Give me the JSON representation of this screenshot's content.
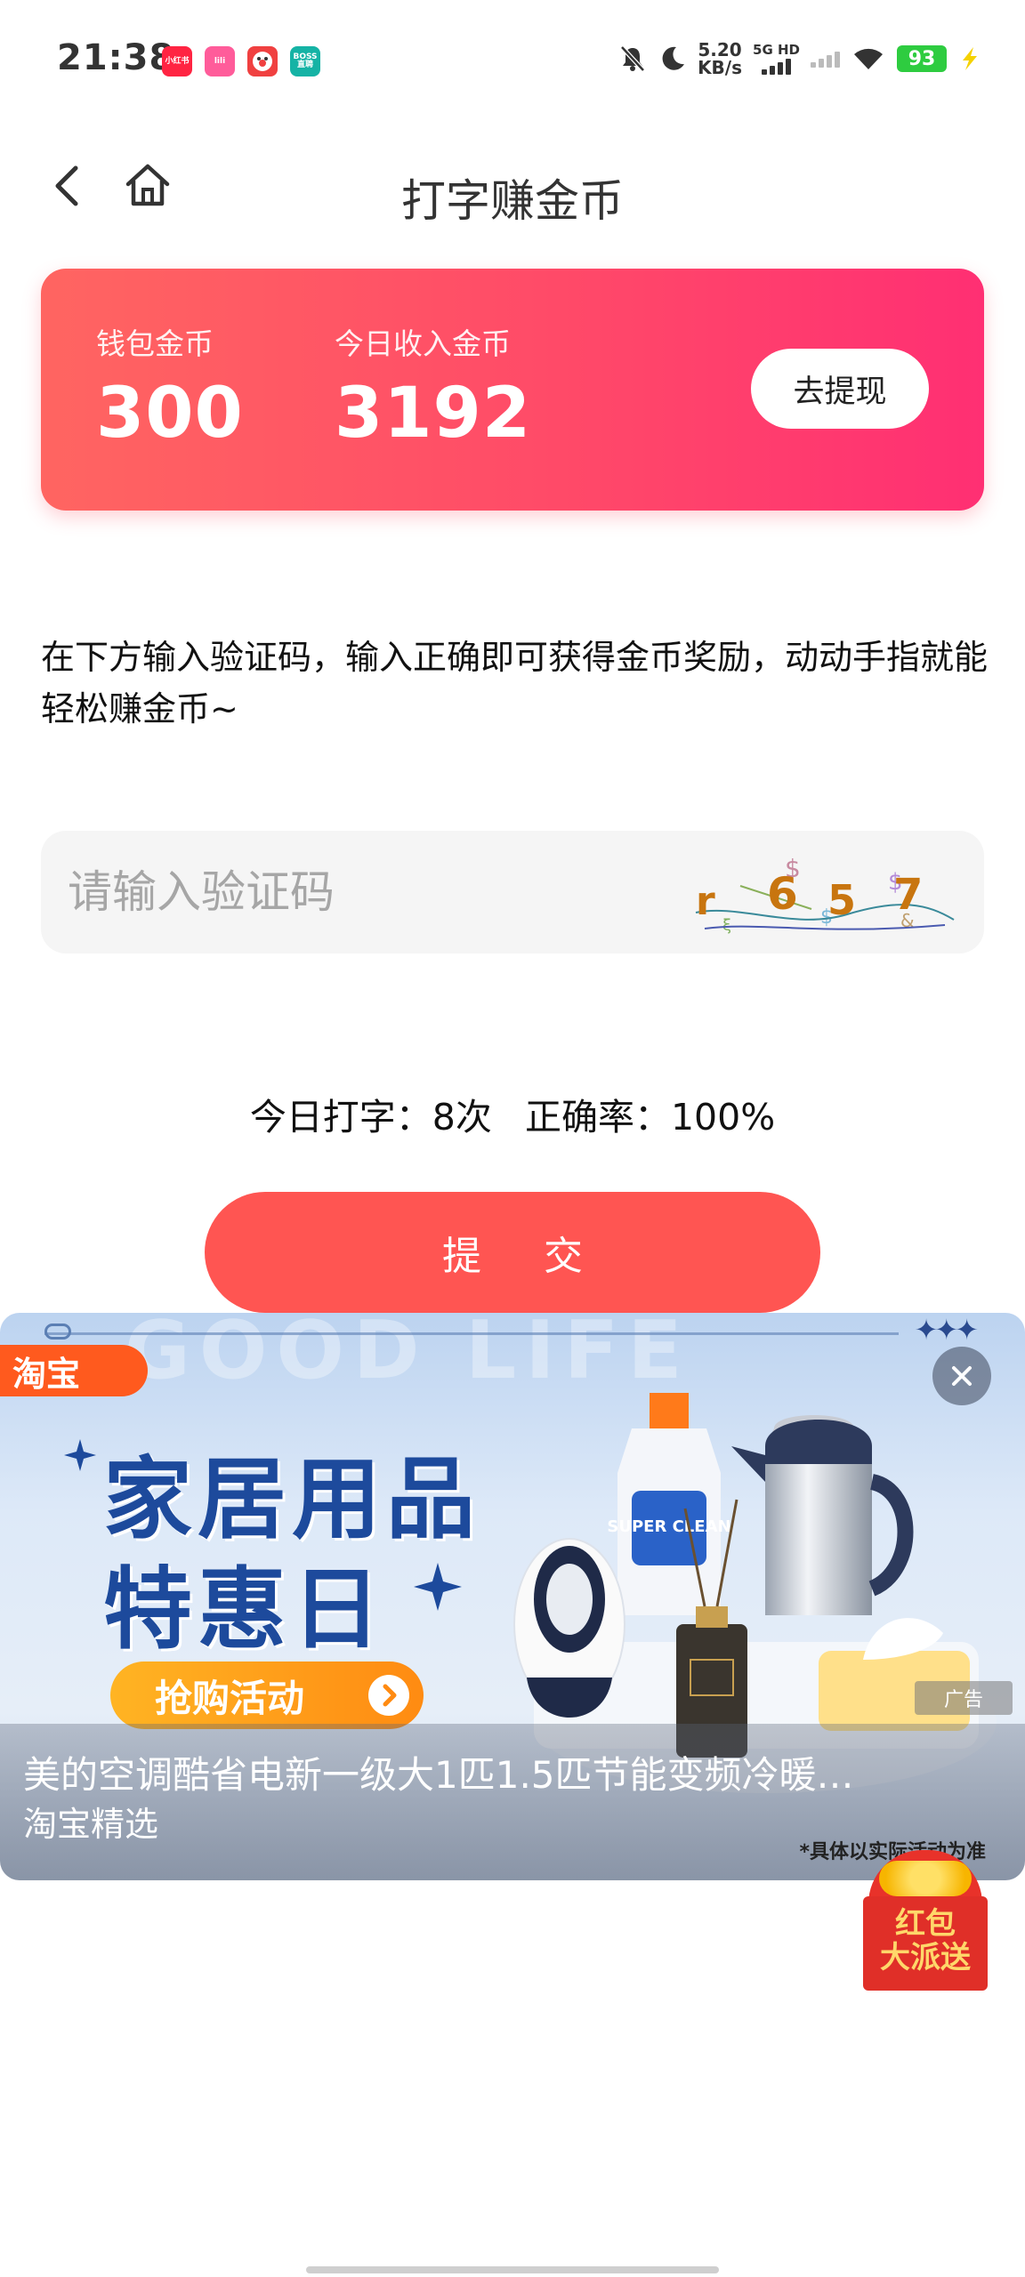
{
  "status_bar": {
    "time": "21:38",
    "apps": [
      {
        "name": "xiaohongshu",
        "text": "小红书",
        "color": "#ff2442"
      },
      {
        "name": "app-pink",
        "text": "lili",
        "color": "#ff5c9a"
      },
      {
        "name": "app-clown",
        "text": "",
        "color": "#f04040"
      },
      {
        "name": "boss-zhipin",
        "text": "BOSS 直聘",
        "color": "#15b3a5"
      }
    ],
    "net_speed_value": "5.20",
    "net_speed_unit": "KB/s",
    "signal_label": "5G HD",
    "battery": "93"
  },
  "header": {
    "title": "打字赚金币",
    "back_icon": "chevron-left-icon",
    "home_icon": "home-icon"
  },
  "wallet": {
    "balance_label": "钱包金币",
    "balance_value": "300",
    "today_label": "今日收入金币",
    "today_value": "3192",
    "withdraw_label": "去提现"
  },
  "instructions": "在下方输入验证码，输入正确即可获得金币奖励，动动手指就能轻松赚金币~",
  "captcha": {
    "placeholder": "请输入验证码",
    "code_chars": [
      "r",
      "6",
      "5",
      "7"
    ]
  },
  "stats": {
    "typed_today": "今日打字：8次",
    "accuracy": "正确率：100%"
  },
  "submit_label": "提 交",
  "ad": {
    "platform_tag": "淘宝",
    "headline_line1": "家居用品",
    "headline_line2": "特惠日",
    "cta_label": "抢购活动",
    "disclaimer": "*具体以实际活动为准",
    "ad_mark": "广告",
    "caption_title": "美的空调酷省电新一级大1匹1.5匹节能变频冷暖…",
    "caption_subtitle": "淘宝精选",
    "bg_text": "GOOD LIFE",
    "bottle_text": "SUPER CLEAN"
  },
  "red_packet": {
    "line1": "红包",
    "line2": "大派送"
  }
}
